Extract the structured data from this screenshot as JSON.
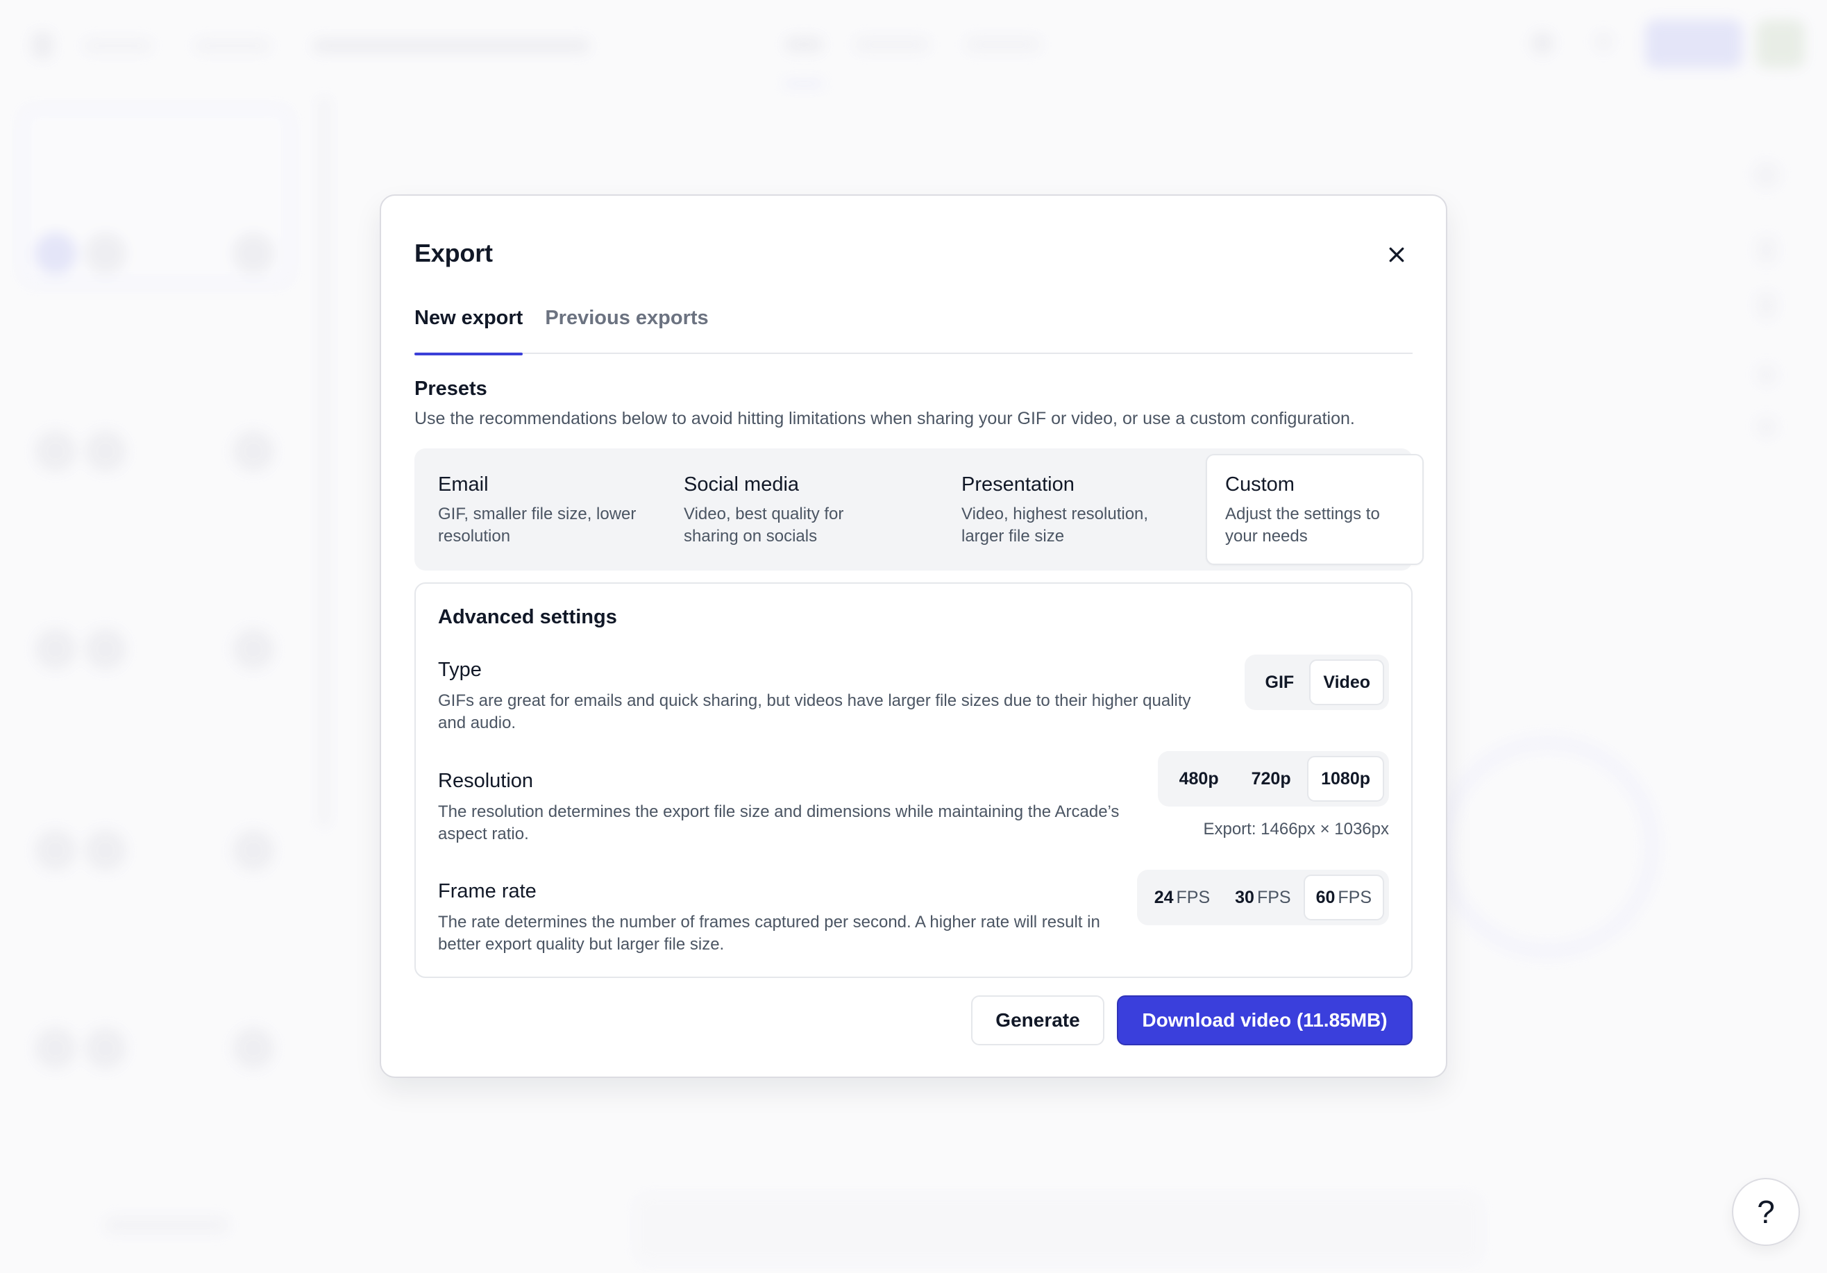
{
  "colors": {
    "accent": "#3a3fdc",
    "tab_underline": "#3b3fd8",
    "text_primary": "#111827",
    "text_secondary": "#4b5563",
    "segment_bg": "#f3f4f6"
  },
  "modal": {
    "title": "Export",
    "close_icon": "close-icon",
    "tabs": [
      {
        "label": "New export",
        "active": true
      },
      {
        "label": "Previous exports",
        "active": false
      }
    ],
    "presets": {
      "title": "Presets",
      "description": "Use the recommendations below to avoid hitting limitations when sharing your GIF or video, or use a custom configuration.",
      "items": [
        {
          "title": "Email",
          "description": "GIF, smaller file size, lower resolution",
          "selected": false
        },
        {
          "title": "Social media",
          "description": "Video, best quality for sharing on socials",
          "selected": false
        },
        {
          "title": "Presentation",
          "description": "Video, highest resolution, larger file size",
          "selected": false
        },
        {
          "title": "Custom",
          "description": "Adjust the settings to your needs",
          "selected": true
        }
      ]
    },
    "advanced": {
      "title": "Advanced settings",
      "type": {
        "label": "Type",
        "description": "GIFs are great for emails and quick sharing, but videos have larger file sizes due to their higher quality and audio.",
        "options": [
          {
            "label": "GIF",
            "selected": false
          },
          {
            "label": "Video",
            "selected": true
          }
        ]
      },
      "resolution": {
        "label": "Resolution",
        "description": "The resolution determines the export file size and dimensions while maintaining the Arcade’s aspect ratio.",
        "options": [
          {
            "label": "480p",
            "selected": false
          },
          {
            "label": "720p",
            "selected": false
          },
          {
            "label": "1080p",
            "selected": true
          }
        ],
        "export_dimensions": "Export: 1466px × 1036px"
      },
      "frame_rate": {
        "label": "Frame rate",
        "description": "The rate determines the number of frames captured per second. A higher rate will result in better export quality but larger file size.",
        "unit": "FPS",
        "options": [
          {
            "value": "24",
            "selected": false
          },
          {
            "value": "30",
            "selected": false
          },
          {
            "value": "60",
            "selected": true
          }
        ]
      }
    },
    "footer": {
      "generate_label": "Generate",
      "download_label": "Download video (11.85MB)"
    }
  },
  "help_button": {
    "label": "?",
    "icon": "help-icon"
  }
}
